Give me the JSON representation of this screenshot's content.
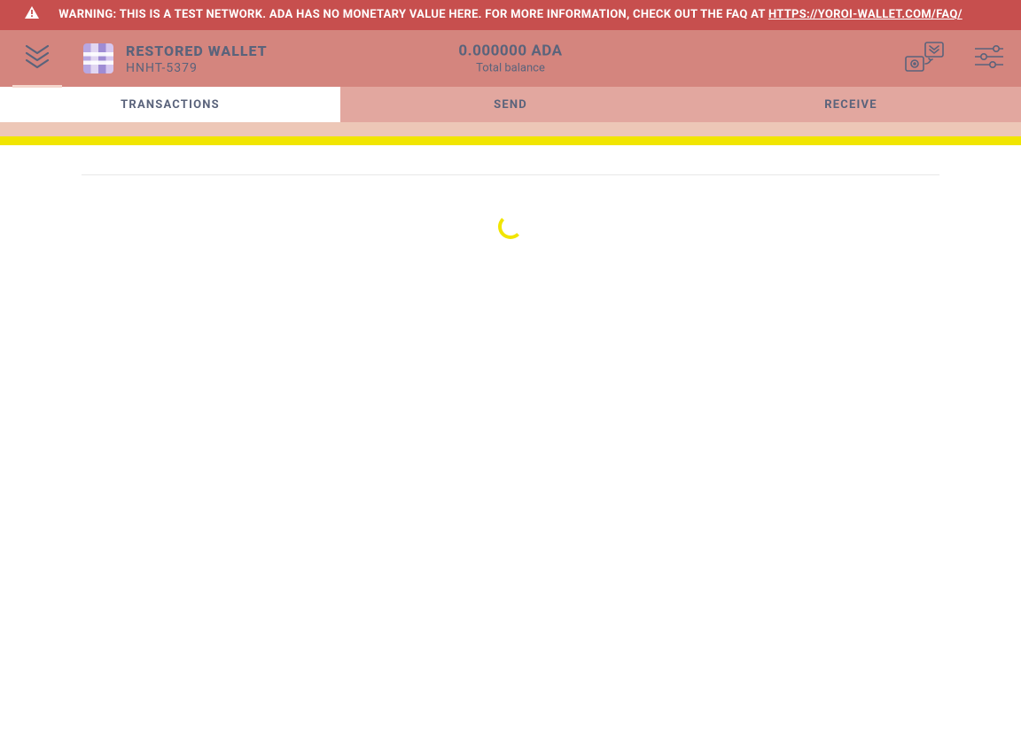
{
  "warning": {
    "text_prefix": "WARNING: THIS IS A TEST NETWORK. ADA HAS NO MONETARY VALUE HERE. FOR MORE INFORMATION, CHECK OUT THE FAQ AT ",
    "link_text": "HTTPS://YOROI-WALLET.COM/FAQ/"
  },
  "wallet": {
    "name": "RESTORED WALLET",
    "id": "HNHT-5379"
  },
  "balance": {
    "amount": "0.000000 ADA",
    "label": "Total balance"
  },
  "tabs": {
    "transactions": "TRANSACTIONS",
    "send": "SEND",
    "receive": "RECEIVE",
    "active": "transactions"
  },
  "colors": {
    "warn_bg": "#c74f4e",
    "header_bg": "#d4857e",
    "header_text": "#5a637b",
    "tab_inactive_bg": "#e2a79f",
    "spinner_yellow": "#f1e500"
  }
}
